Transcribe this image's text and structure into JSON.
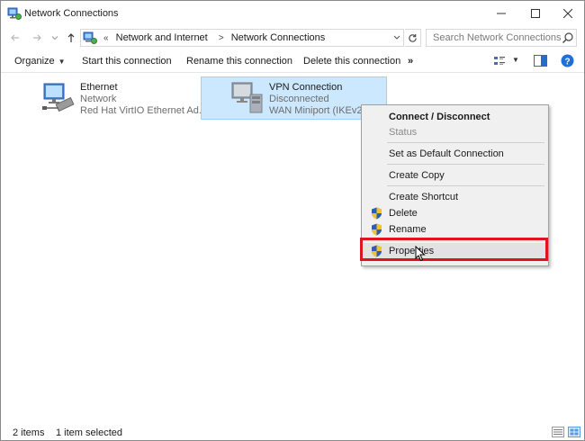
{
  "window": {
    "title": "Network Connections"
  },
  "addressbar": {
    "recent_glyph": "«",
    "crumbs": [
      "Network and Internet",
      "Network Connections"
    ],
    "search_placeholder": "Search Network Connections"
  },
  "commandbar": {
    "organize": "Organize",
    "start": "Start this connection",
    "rename": "Rename this connection",
    "delete": "Delete this connection",
    "more": "»",
    "help": "?"
  },
  "connections": [
    {
      "name": "Ethernet",
      "state": "Network",
      "device": "Red Hat VirtIO Ethernet Ad..."
    },
    {
      "name": "VPN Connection",
      "state": "Disconnected",
      "device": "WAN Miniport (IKEv2)"
    }
  ],
  "context_menu": {
    "connect_disconnect": "Connect / Disconnect",
    "status": "Status",
    "set_default": "Set as Default Connection",
    "create_copy": "Create Copy",
    "create_shortcut": "Create Shortcut",
    "delete": "Delete",
    "rename": "Rename",
    "properties": "Properties"
  },
  "statusbar": {
    "items": "2 items",
    "selected": "1 item selected"
  },
  "colors": {
    "selection_fill": "#cce8ff",
    "selection_border": "#99d1ff",
    "highlight_box": "#e0141e",
    "help_blue": "#1e6fd9"
  },
  "icons": {
    "app": "network-connections-icon",
    "back": "back-arrow-icon",
    "forward": "forward-arrow-icon",
    "up": "up-arrow-icon",
    "refresh": "refresh-icon",
    "search": "search-icon",
    "shield": "uac-shield-icon"
  }
}
